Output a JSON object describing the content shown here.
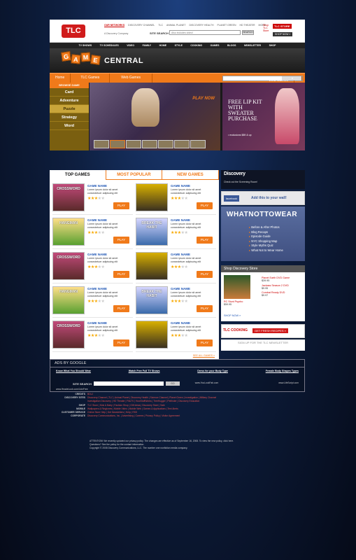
{
  "header": {
    "logo": "TLC",
    "net": [
      "OUR NETWORKS",
      "DISCOVERY CHANNEL",
      "TLC",
      "ANIMAL PLANET",
      "DISCOVERY HEALTH",
      "PLANET GREEN",
      "HD THEATER",
      "MORE"
    ],
    "tagline": "A Discovery Company",
    "search_label": "SITE SEARCH",
    "search_placeholder": "Also includes video!",
    "search_btn": "SEARCH",
    "promo": "Shop TLC Store",
    "store": "TLC STORE",
    "shopnow": "SHOP NOW »"
  },
  "nav": [
    "TV SHOWS",
    "TV SCHEDULES",
    "VIDEO",
    "FAMILY",
    "HOME",
    "STYLE",
    "COOKING",
    "GAMES",
    "BLOGS",
    "NEWSLETTER",
    "SHOP"
  ],
  "gc": {
    "tiles": [
      "G",
      "A",
      "M",
      "E"
    ],
    "central": "CENTRAL",
    "tabs": [
      "Home",
      "TLC Games",
      "Web Games"
    ],
    "select": "Web Games",
    "arrow": "▾"
  },
  "browse": {
    "head": "BROWSE GAME",
    "items": [
      "Card",
      "Adventure",
      "Puzzle",
      "Strategy",
      "Word"
    ]
  },
  "feature": {
    "playnow": "PLAY NOW"
  },
  "ad": {
    "text": "FREE LIP KIT WITH SWEATER PURCHASE",
    "small": "• exclusions $89 & up"
  },
  "tabs": [
    "TOP GAMES",
    "MOST POPULAR",
    "NEW GAMES"
  ],
  "games": [
    {
      "thumb": "CROSSWORD",
      "name": "GAME NAME",
      "desc": "Lorem ipsum dolor sit amet consectetuer adipiscing elit",
      "stars": "★★★",
      "off": "★★",
      "play": "PLAY"
    },
    {
      "thumb": "",
      "name": "GAME NAME",
      "desc": "Lorem ipsum dolor sit amet consectetuer adipiscing elit",
      "stars": "★★★",
      "off": "★★",
      "play": "PLAY"
    },
    {
      "thumb": "HANGMAN",
      "name": "GAME NAME",
      "desc": "Lorem ipsum dolor sit amet consectetuer adipiscing elit",
      "stars": "★★★",
      "off": "★★",
      "play": "PLAY"
    },
    {
      "thumb": "BREAK THE HABIT",
      "name": "GAME NAME",
      "desc": "Lorem ipsum dolor sit amet consectetuer adipiscing elit",
      "stars": "★★★",
      "off": "★★",
      "play": "PLAY"
    },
    {
      "thumb": "CROSSWORD",
      "name": "GAME NAME",
      "desc": "Lorem ipsum dolor sit amet consectetuer adipiscing elit",
      "stars": "★★★",
      "off": "★★",
      "play": "PLAY"
    },
    {
      "thumb": "",
      "name": "GAME NAME",
      "desc": "Lorem ipsum dolor sit amet consectetuer adipiscing elit",
      "stars": "★★★",
      "off": "★★",
      "play": "PLAY"
    },
    {
      "thumb": "HANGMAN",
      "name": "GAME NAME",
      "desc": "Lorem ipsum dolor sit amet consectetuer adipiscing elit",
      "stars": "★★★",
      "off": "★★",
      "play": "PLAY"
    },
    {
      "thumb": "BREAK THE HABIT",
      "name": "GAME NAME",
      "desc": "Lorem ipsum dolor sit amet consectetuer adipiscing elit",
      "stars": "★★★",
      "off": "★★",
      "play": "PLAY"
    },
    {
      "thumb": "CROSSWORD",
      "name": "GAME NAME",
      "desc": "Lorem ipsum dolor sit amet consectetuer adipiscing elit",
      "stars": "★★★",
      "off": "★★",
      "play": "PLAY"
    },
    {
      "thumb": "",
      "name": "GAME NAME",
      "desc": "Lorem ipsum dolor sit amet consectetuer adipiscing elit",
      "stars": "★★★",
      "off": "★★",
      "play": "PLAY"
    }
  ],
  "seeall": "SEE ALL GAMES »",
  "sidebar": {
    "disc": "Discovery",
    "disc_sub": "Check out the Screening Room!",
    "fb": "facebook",
    "fb_text": "Add this to your wall!",
    "wnw_title": "WHATNOTTOWEAR",
    "wnw_items": [
      "Before & After Photos",
      "Blog Recaps",
      "Episode Guide",
      "NYC Shopping Map",
      "Style Myths Quiz",
      "What Not to Wear Home"
    ],
    "store_head": "Shop Discovery Store",
    "product": "RC Stunt Psycho",
    "product_price": "$59.95",
    "items": [
      {
        "n": "Planet Earth DVD Game",
        "p": "$39.95"
      },
      {
        "n": "Jackass Season 2 DVD",
        "p": "$9.95"
      },
      {
        "n": "Combat Ready DVD",
        "p": "$9.97"
      }
    ],
    "shopnow": "SHOP NOW »",
    "cook": "TLC COOKING",
    "recipes": "GET FRESH RECIPES »",
    "newsletter": "SIGN UP FOR THE TLC NEWSLETTER"
  },
  "ads": {
    "head": "ADS BY GOOGLE",
    "links": [
      "Know What You Should Wear",
      "Watch Free Full TV Shows",
      "Dress for your Body Type",
      "Female Body Shapes Types"
    ],
    "urls": [
      "www.Parcsyz.com",
      "www.YouLookFab.com",
      "www.LifeScript.com"
    ],
    "url2": "www.HeadeLook.com/JoinFree"
  },
  "footer": {
    "search_label": "SITE SEARCH",
    "select": "GO",
    "rows": [
      {
        "l": "CREDITS",
        "v": "BDLJ"
      },
      {
        "l": "DISCOVERY SITES",
        "v": "Discovery Channel | TLC | Animal Planet | Discovery Health | Science Channel | Planet Green | Investigation | Military Channel"
      },
      {
        "l": "",
        "v": "Investigation Discovery | HD Theater | Fit&TV | HowStuffWorks | TreeHugger | Petfinder | Discovery Education"
      },
      {
        "l": "SHOP",
        "v": "TLC Store | Kids & Baby | Fashion Shop | Gift Ideas | Discovery Store | Sale"
      },
      {
        "l": "MOBILE",
        "v": "Wallpapers & Ringtones | Mobile Video | Mobile Web | Games & Applications | Text Alerts"
      },
      {
        "l": "CUSTOMER SERVICE",
        "v": "Online Store Help | Get Newsletters | Help | RSS"
      },
      {
        "l": "CORPORATE",
        "v": "Discovery Communications, Inc. | Advertising | Careers | Privacy Policy | Visitor Agreement"
      }
    ],
    "legal": [
      "ATTENTION! We recently updated our privacy policy. The changes are effective as of September 16, 2008. To view the new policy, click here.",
      "Questions? See the policy for the contact information.",
      "Copyright © 2008 Discovery Communications, LLC. The number one nonfiction media company."
    ]
  }
}
